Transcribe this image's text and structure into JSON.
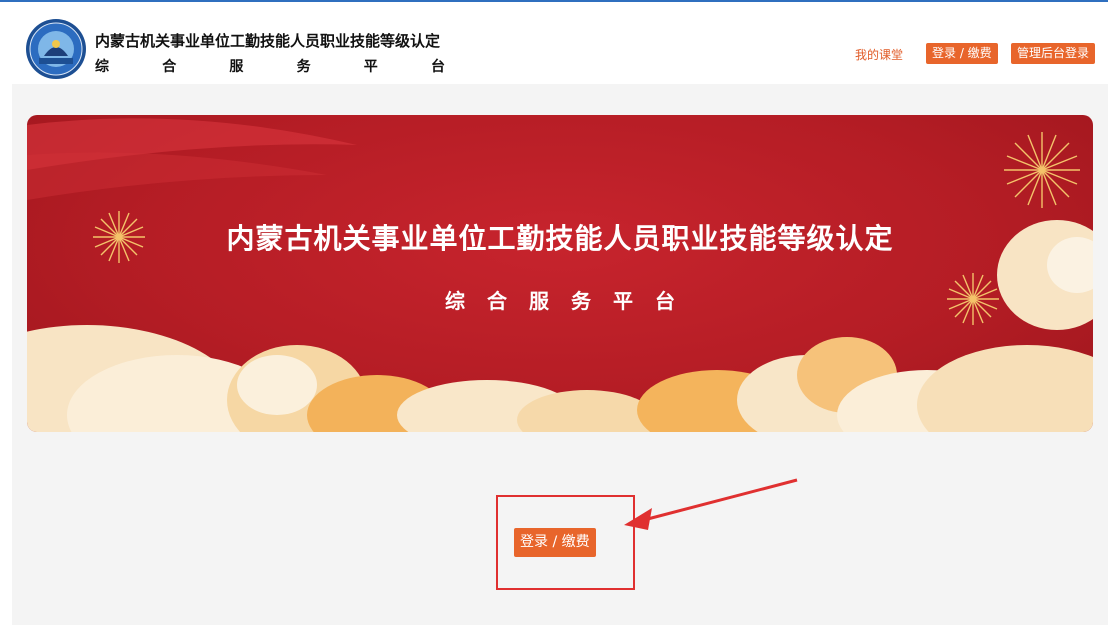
{
  "header": {
    "title": "内蒙古机关事业单位工勤技能人员职业技能等级认定",
    "subtitle_chars": [
      "综",
      "合",
      "服",
      "务",
      "平",
      "台"
    ]
  },
  "nav": {
    "my_class": "我的课堂",
    "login_pay": "登录 / 缴费",
    "admin_login": "管理后台登录"
  },
  "banner": {
    "title": "内蒙古机关事业单位工勤技能人员职业技能等级认定",
    "subtitle": "综合服务平台"
  },
  "cta": {
    "login_pay": "登录 / 缴费"
  },
  "colors": {
    "accent": "#e8652b",
    "banner_red": "#b51d25",
    "annotation_red": "#e03030",
    "top_line": "#2f6fbf"
  },
  "icons": {
    "logo": "emblem-logo",
    "firework": "firework-icon",
    "cloud": "auspicious-cloud"
  }
}
